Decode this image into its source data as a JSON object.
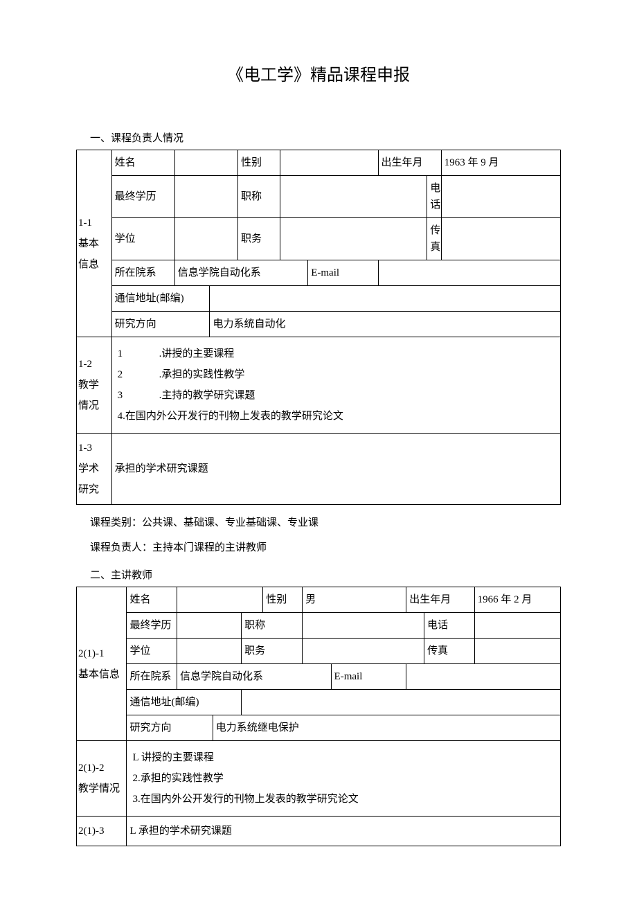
{
  "title": "《电工学》精品课程申报",
  "section1": {
    "heading": "一、课程负责人情况",
    "sideLabel": "1-1\n基本\n信息",
    "labels": {
      "name": "姓名",
      "gender": "性别",
      "birth": "出生年月",
      "edu": "最终学历",
      "title": "职称",
      "phone": "电话",
      "degree": "学位",
      "position": "职务",
      "fax": "传真",
      "dept": "所在院系",
      "email": "E-mail",
      "addr": "通信地址(邮编)",
      "research": "研究方向"
    },
    "values": {
      "name": "",
      "gender": "",
      "birth": "1963 年 9 月",
      "edu": "",
      "titleV": "",
      "phone": "",
      "degree": "",
      "position": "",
      "fax": "",
      "dept": "信息学院自动化系",
      "email": "",
      "addr": "",
      "research": "电力系统自动化"
    },
    "teachSide": "1-2\n教学情况",
    "teachItems": {
      "i1n": "1",
      "i1t": ".讲授的主要课程",
      "i2n": "2",
      "i2t": ".承担的实践性教学",
      "i3n": "3",
      "i3t": ".主持的教学研究课题",
      "i4": "4.在国内外公开发行的刊物上发表的教学研究论文"
    },
    "acadSide": "1-3\n学术\n研究",
    "acadText": "承担的学术研究课题",
    "note1": "课程类别：公共课、基础课、专业基础课、专业课",
    "note2": "课程负责人：主持本门课程的主讲教师"
  },
  "section2": {
    "heading": "二、主讲教师",
    "sideLabel": "2(1)-1\n基本信息",
    "labels": {
      "name": "姓名",
      "gender": "性别",
      "birth": "出生年月",
      "edu": "最终学历",
      "title": "职称",
      "phone": "电话",
      "degree": "学位",
      "position": "职务",
      "fax": "传真",
      "dept": "所在院系",
      "email": "E-mail",
      "addr": "通信地址(邮编)",
      "research": "研究方向"
    },
    "values": {
      "name": "",
      "gender": "男",
      "birth": "1966 年 2 月",
      "edu": "",
      "titleV": "",
      "phone": "",
      "degree": "",
      "position": "",
      "fax": "",
      "dept": "信息学院自动化系",
      "email": "",
      "addr": "",
      "research": "电力系统继电保护"
    },
    "teachSide": "2(1)-2\n教学情况",
    "teachItems": {
      "i1": "L 讲授的主要课程",
      "i2": "2.承担的实践性教学",
      "i3": "3.在国内外公开发行的刊物上发表的教学研究论文"
    },
    "acadSide": "2(1)-3",
    "acadText": "L 承担的学术研究课题"
  }
}
